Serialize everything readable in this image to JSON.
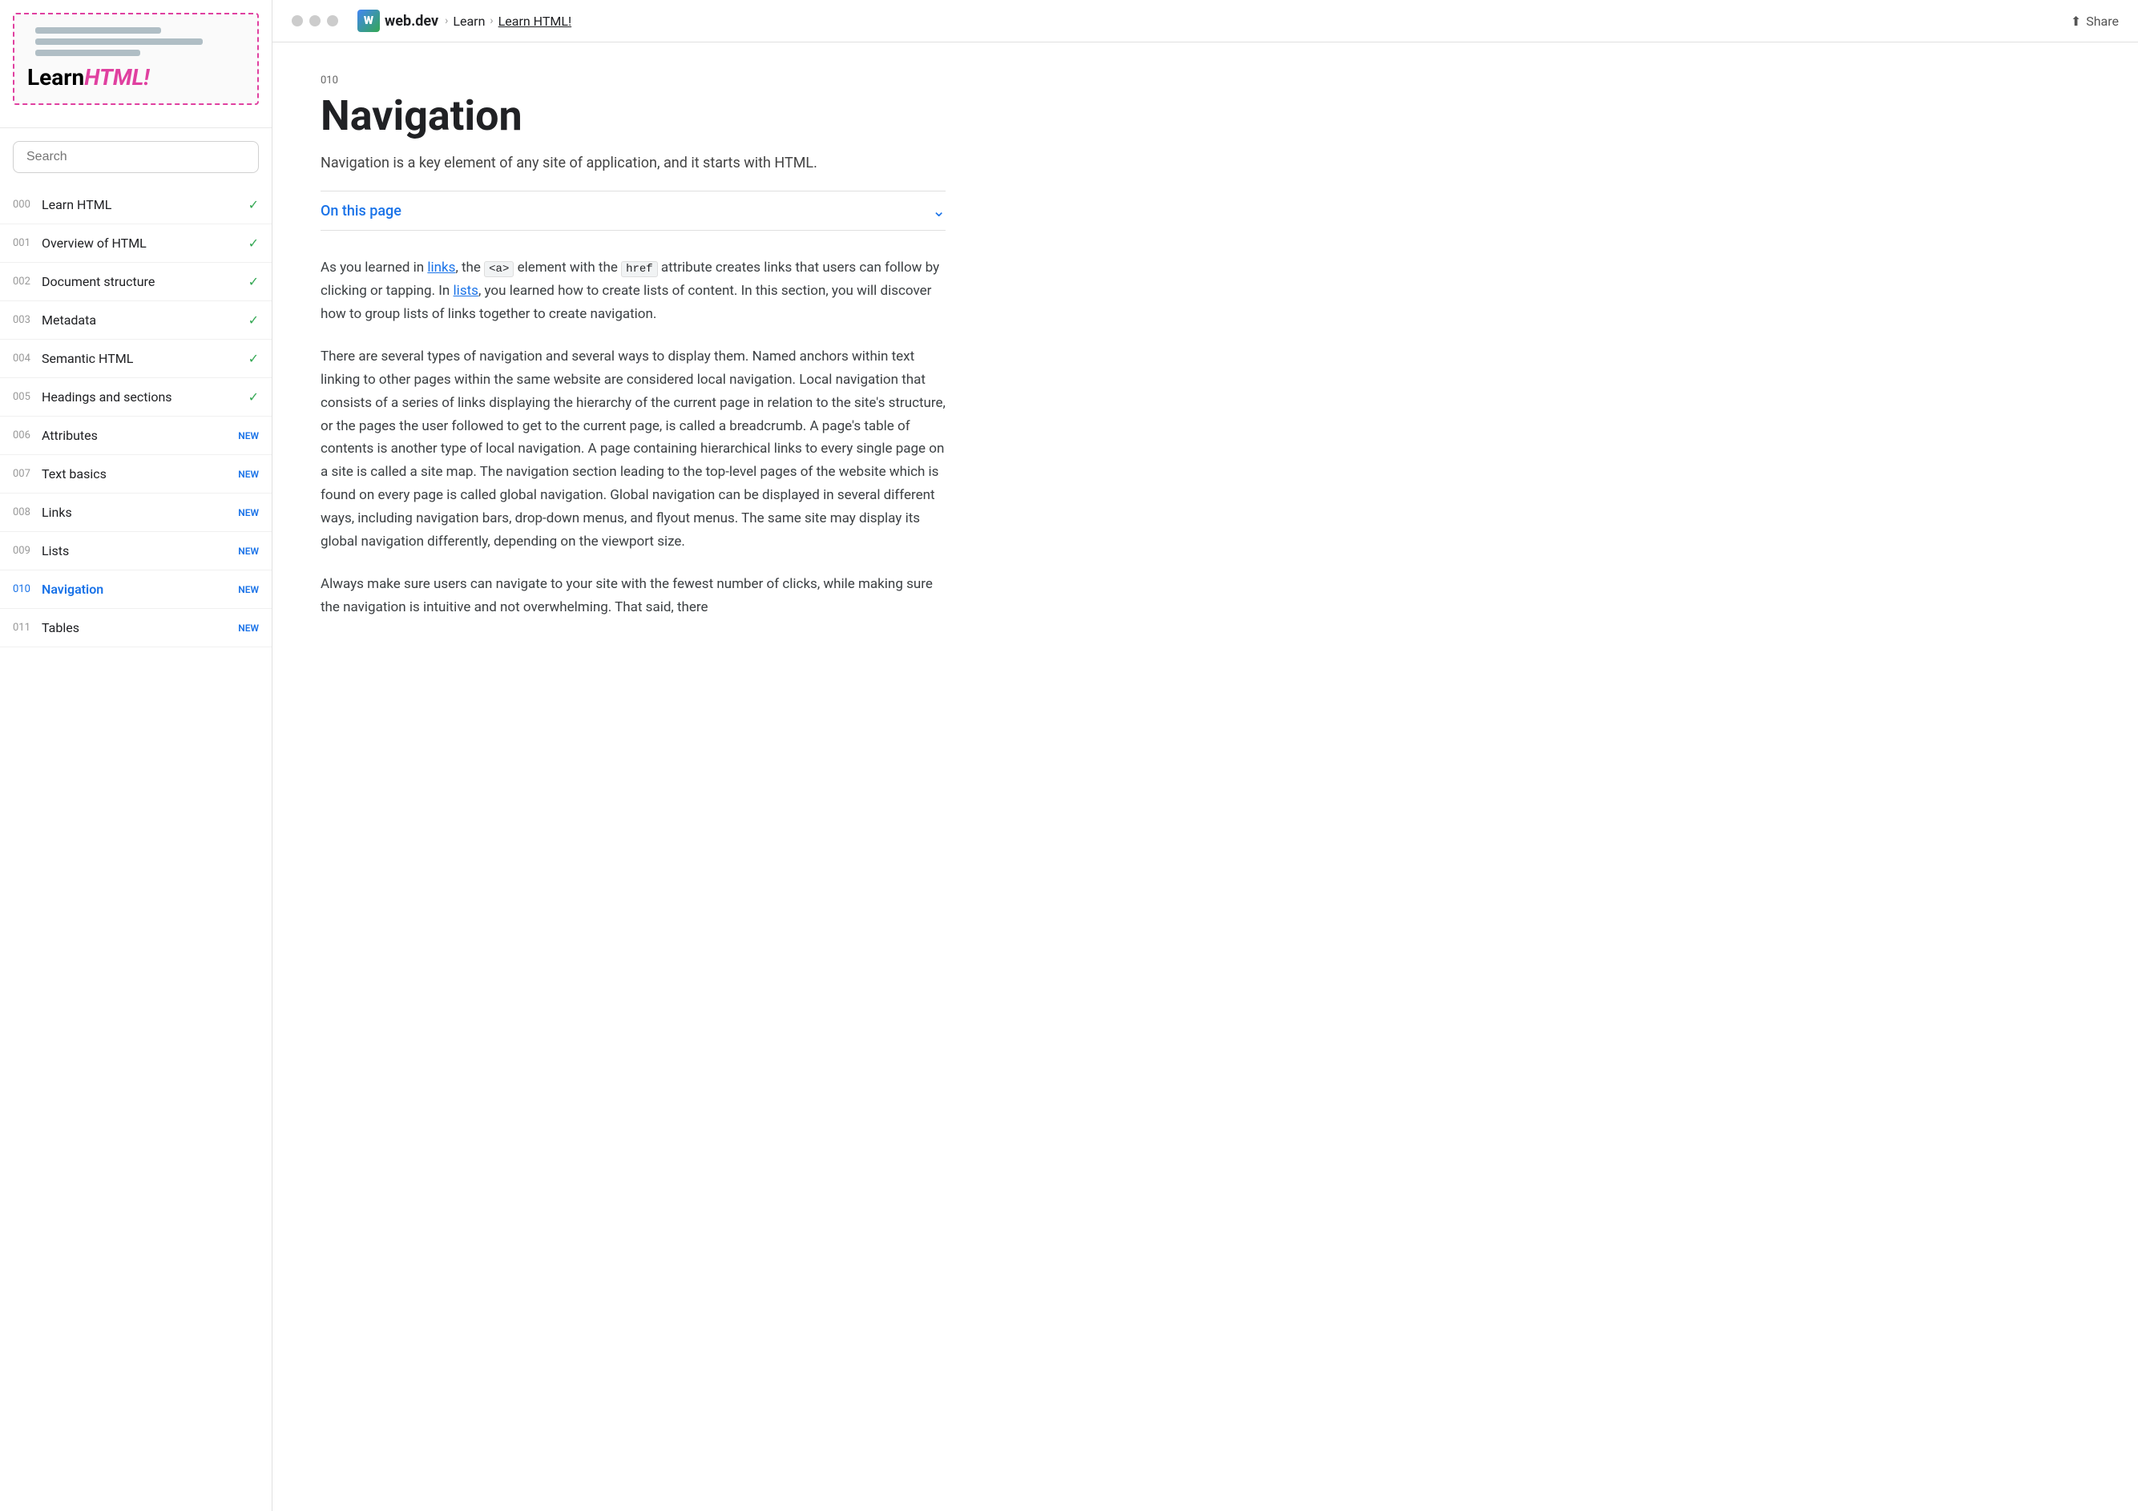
{
  "sidebar": {
    "logo": {
      "learn_text": "Learn",
      "html_text": "HTML!"
    },
    "search": {
      "placeholder": "Search"
    },
    "nav_items": [
      {
        "num": "000",
        "label": "Learn HTML",
        "badge": "",
        "checked": true
      },
      {
        "num": "001",
        "label": "Overview of HTML",
        "badge": "",
        "checked": true
      },
      {
        "num": "002",
        "label": "Document structure",
        "badge": "",
        "checked": true
      },
      {
        "num": "003",
        "label": "Metadata",
        "badge": "",
        "checked": true
      },
      {
        "num": "004",
        "label": "Semantic HTML",
        "badge": "",
        "checked": true
      },
      {
        "num": "005",
        "label": "Headings and sections",
        "badge": "",
        "checked": true
      },
      {
        "num": "006",
        "label": "Attributes",
        "badge": "NEW",
        "checked": false
      },
      {
        "num": "007",
        "label": "Text basics",
        "badge": "NEW",
        "checked": false
      },
      {
        "num": "008",
        "label": "Links",
        "badge": "NEW",
        "checked": false
      },
      {
        "num": "009",
        "label": "Lists",
        "badge": "NEW",
        "checked": false
      },
      {
        "num": "010",
        "label": "Navigation",
        "badge": "NEW",
        "checked": false,
        "active": true
      },
      {
        "num": "011",
        "label": "Tables",
        "badge": "NEW",
        "checked": false
      }
    ]
  },
  "topnav": {
    "site_name": "web.dev",
    "breadcrumb_sep": ">",
    "learn_link": "Learn",
    "learn_html_link": "Learn HTML!",
    "share_label": "Share"
  },
  "article": {
    "num": "010",
    "title": "Navigation",
    "subtitle": "Navigation is a key element of any site of application, and it starts with HTML.",
    "on_this_page": "On this page",
    "paragraphs": [
      "As you learned in links, the <a> element with the href attribute creates links that users can follow by clicking or tapping. In lists, you learned how to create lists of content. In this section, you will discover how to group lists of links together to create navigation.",
      "There are several types of navigation and several ways to display them. Named anchors within text linking to other pages within the same website are considered local navigation. Local navigation that consists of a series of links displaying the hierarchy of the current page in relation to the site's structure, or the pages the user followed to get to the current page, is called a breadcrumb. A page's table of contents is another type of local navigation. A page containing hierarchical links to every single page on a site is called a site map. The navigation section leading to the top-level pages of the website which is found on every page is called global navigation. Global navigation can be displayed in several different ways, including navigation bars, drop-down menus, and flyout menus. The same site may display its global navigation differently, depending on the viewport size.",
      "Always make sure users can navigate to your site with the fewest number of clicks, while making sure the navigation is intuitive and not overwhelming. That said, there"
    ]
  }
}
